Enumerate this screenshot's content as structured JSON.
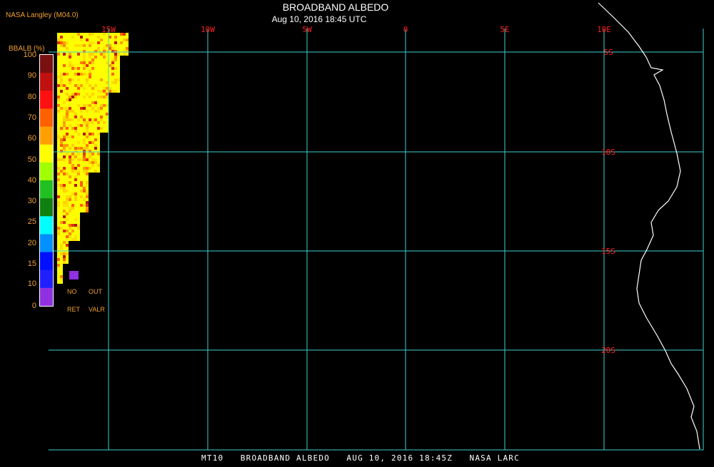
{
  "header": {
    "credit": "NASA Langley (M04.0)",
    "title": "BROADBAND ALBEDO",
    "subtitle": "Aug 10, 2016 18:45 UTC"
  },
  "footer": {
    "text": "MT10   BROADBAND ALBEDO   AUG 10, 2016 18:45Z   NASA LARC"
  },
  "map": {
    "longitude_labels": [
      "15W",
      "10W",
      "5W",
      "0",
      "5E",
      "10E"
    ],
    "latitude_labels": [
      "5S",
      "10S",
      "15S",
      "20S"
    ],
    "grid_color": "#40d0d0",
    "label_color": "#ff2020",
    "coastline_color": "#ffffff"
  },
  "legend": {
    "title": "BBALB (%)",
    "ticks": [
      "100",
      "90",
      "80",
      "70",
      "60",
      "50",
      "40",
      "30",
      "25",
      "20",
      "15",
      "10",
      "0"
    ],
    "colors_top_to_bottom": [
      "#7a1010",
      "#c01010",
      "#ff1010",
      "#ff6000",
      "#ffa000",
      "#ffff00",
      "#a0ff00",
      "#20c020",
      "#108010",
      "#00ffff",
      "#0090ff",
      "#0010ff",
      "#2020ff",
      "#9030e0"
    ],
    "no_retrieval_label_1": "NO",
    "no_retrieval_label_2": "RET",
    "out_of_range_label_1": "OUT",
    "out_of_range_label_2": "VALR"
  }
}
